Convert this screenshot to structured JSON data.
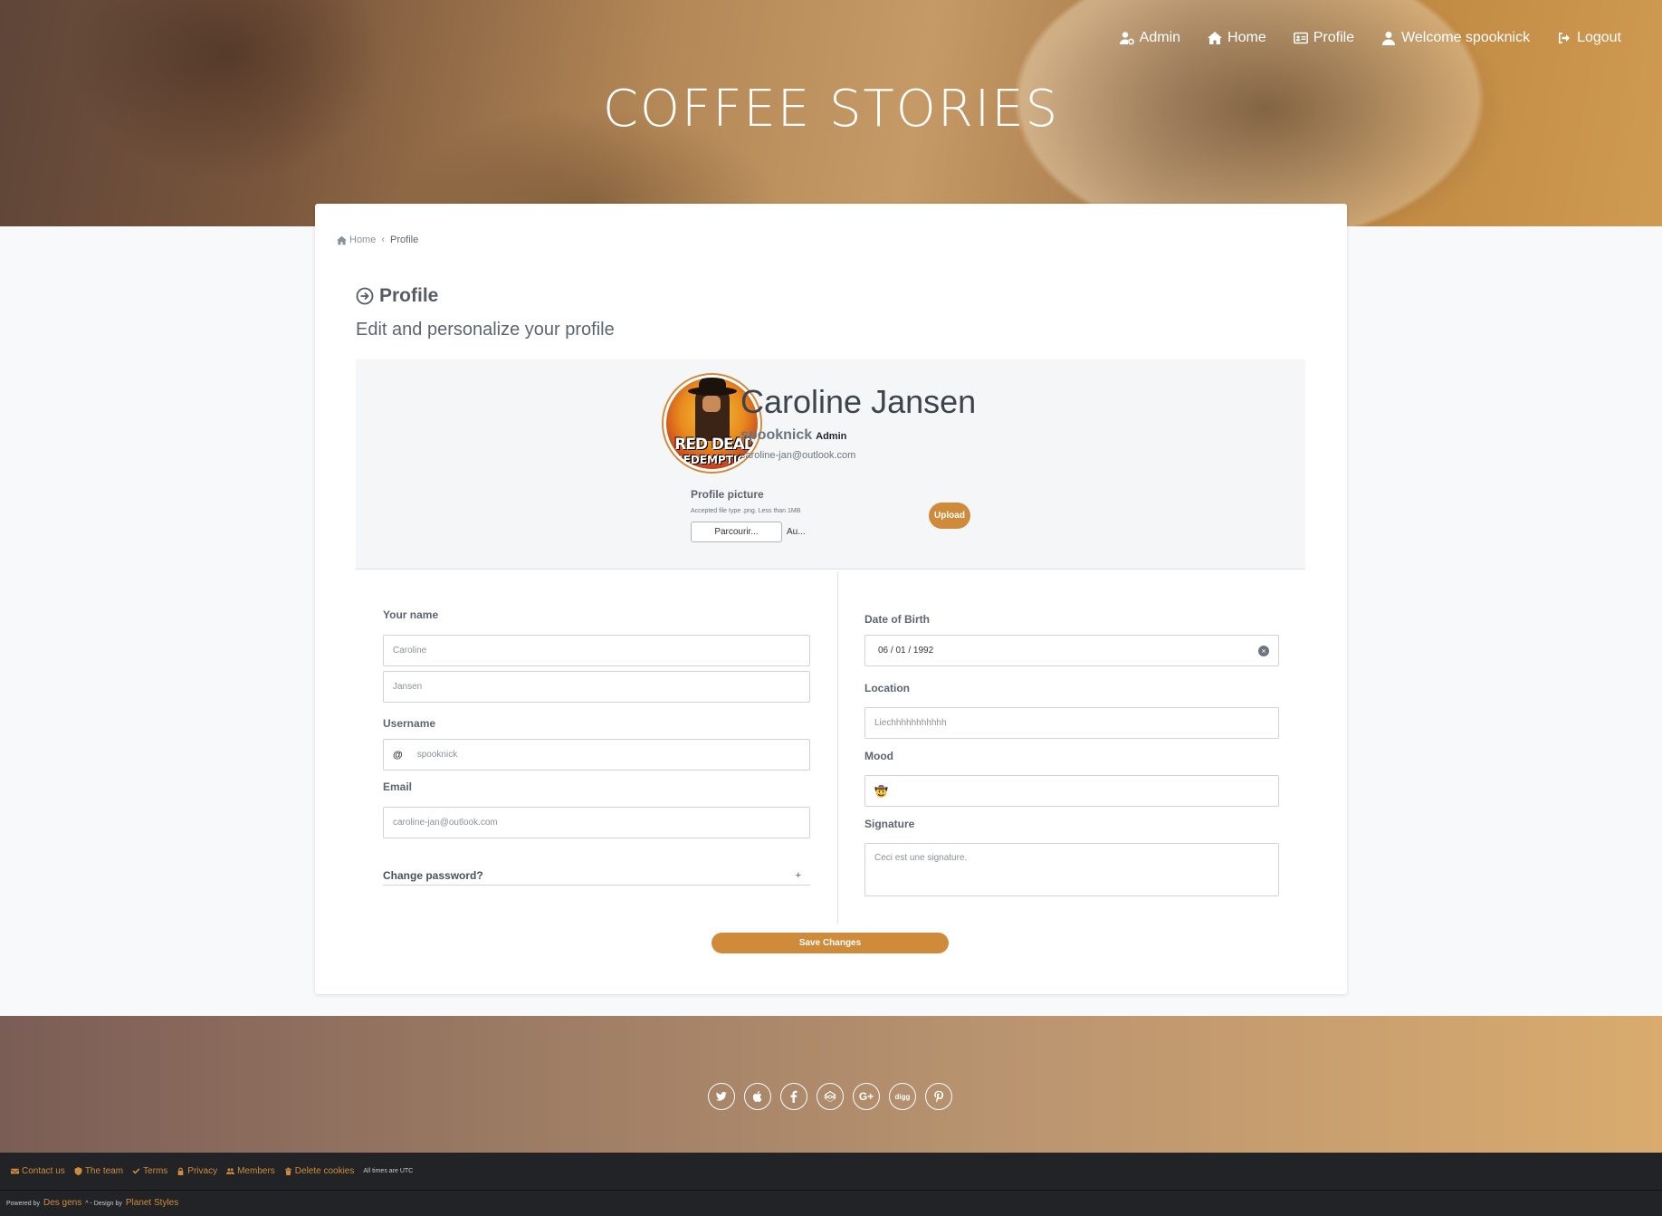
{
  "header": {
    "title": "COFFEE STORIES",
    "nav": [
      {
        "label": "Admin",
        "icon": "user-cog-icon"
      },
      {
        "label": "Home",
        "icon": "home-icon"
      },
      {
        "label": "Profile",
        "icon": "id-card-icon"
      },
      {
        "label": "Welcome spooknick",
        "icon": "user-icon"
      },
      {
        "label": "Logout",
        "icon": "logout-icon"
      }
    ]
  },
  "breadcrumb": {
    "home": "Home",
    "current": "Profile"
  },
  "page": {
    "title": "Profile",
    "subtitle": "Edit and personalize your profile"
  },
  "profile": {
    "full_name": "Caroline Jansen",
    "username": "spooknick",
    "role": "Admin",
    "email": "caroline-jan@outlook.com",
    "avatar_text_1": "RED DEAD",
    "avatar_text_2": "REDEMPTION"
  },
  "picture": {
    "label": "Profile picture",
    "help": "Accepted file type .png. Less than 1MB",
    "browse_label": "Parcourir...",
    "file_label": "Au...",
    "upload_label": "Upload"
  },
  "form": {
    "name_label": "Your name",
    "first_name_placeholder": "Caroline",
    "last_name_placeholder": "Jansen",
    "username_label": "Username",
    "username_prefix": "@",
    "username_placeholder": "spooknick",
    "email_label": "Email",
    "email_placeholder": "caroline-jan@outlook.com",
    "change_password_label": "Change password?",
    "change_password_toggle": "+",
    "dob_label": "Date of Birth",
    "dob_value": "06 / 01 / 1992",
    "location_label": "Location",
    "location_placeholder": "Liechhhhhhhhhhh",
    "mood_label": "Mood",
    "mood_value": "🤠",
    "signature_label": "Signature",
    "signature_placeholder": "Ceci est une signature.",
    "save_label": "Save Changes"
  },
  "footer": {
    "socials": [
      "twitter-icon",
      "apple-icon",
      "facebook-icon",
      "codepen-icon",
      "google-plus-icon",
      "digg-icon",
      "pinterest-icon"
    ],
    "links": [
      {
        "label": "Contact us",
        "icon": "envelope-icon"
      },
      {
        "label": "The team",
        "icon": "shield-icon"
      },
      {
        "label": "Terms",
        "icon": "check-icon"
      },
      {
        "label": "Privacy",
        "icon": "lock-icon"
      },
      {
        "label": "Members",
        "icon": "users-icon"
      },
      {
        "label": "Delete cookies",
        "icon": "trash-icon"
      }
    ],
    "utc": "All times are UTC",
    "powered_by": "Powered by",
    "powered_link": "Des gens",
    "design_by": "^ - Design by",
    "design_link": "Planet Styles"
  },
  "colors": {
    "accent": "#d08b3a",
    "footer_bar": "#222326"
  }
}
